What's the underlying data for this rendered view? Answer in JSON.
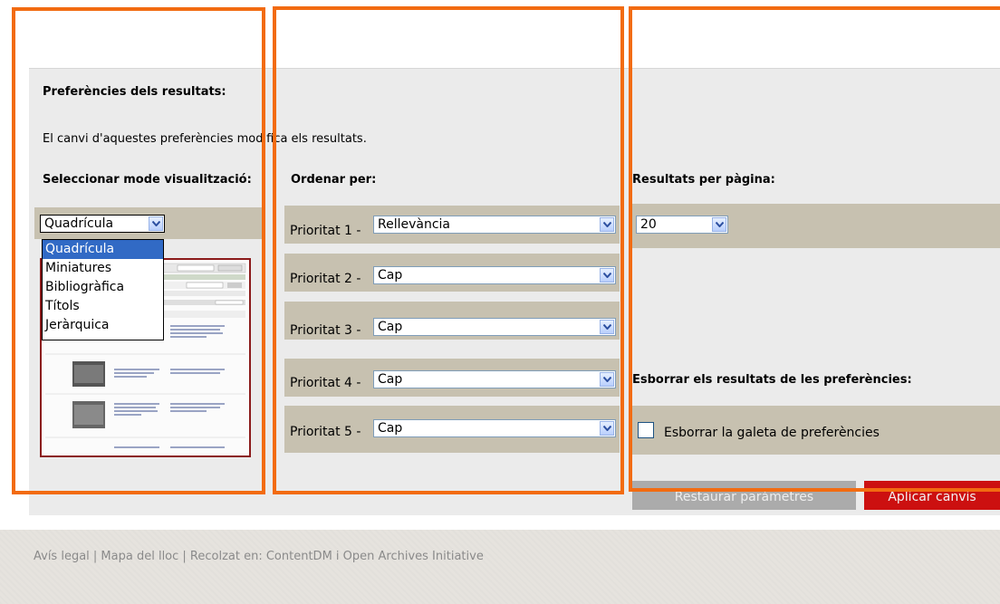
{
  "preferences": {
    "title": "Preferències dels resultats:",
    "notice": "El canvi d'aquestes preferències modifica els resultats."
  },
  "view_mode": {
    "label": "Seleccionar mode visualització:",
    "selected": "Quadrícula",
    "options": [
      "Quadrícula",
      "Miniatures",
      "Bibliogràfica",
      "Títols",
      "Jeràrquica"
    ]
  },
  "sort": {
    "label": "Ordenar per:",
    "priorities": [
      {
        "label": "Prioritat 1 -",
        "value": "Rellevància"
      },
      {
        "label": "Prioritat 2 -",
        "value": "Cap"
      },
      {
        "label": "Prioritat 3 -",
        "value": "Cap"
      },
      {
        "label": "Prioritat 4 -",
        "value": "Cap"
      },
      {
        "label": "Prioritat 5 -",
        "value": "Cap"
      }
    ]
  },
  "per_page": {
    "label": "Resultats per pàgina:",
    "value": "20"
  },
  "clear": {
    "label": "Esborrar els resultats de les preferències:",
    "checkbox_label": "Esborrar la galeta de preferències",
    "checked": false
  },
  "buttons": {
    "reset": "Restaurar paràmetres",
    "apply": "Aplicar canvis"
  },
  "footer": {
    "text": "Avís legal | Mapa del lloc | Recolzat en: ContentDM i Open Archives Initiative"
  },
  "colors": {
    "highlight": "#f26b11",
    "panel": "#ebebeb",
    "strip": "#c7c1b0",
    "apply": "#cc1010",
    "reset": "#ababab",
    "selection": "#316ac5"
  }
}
